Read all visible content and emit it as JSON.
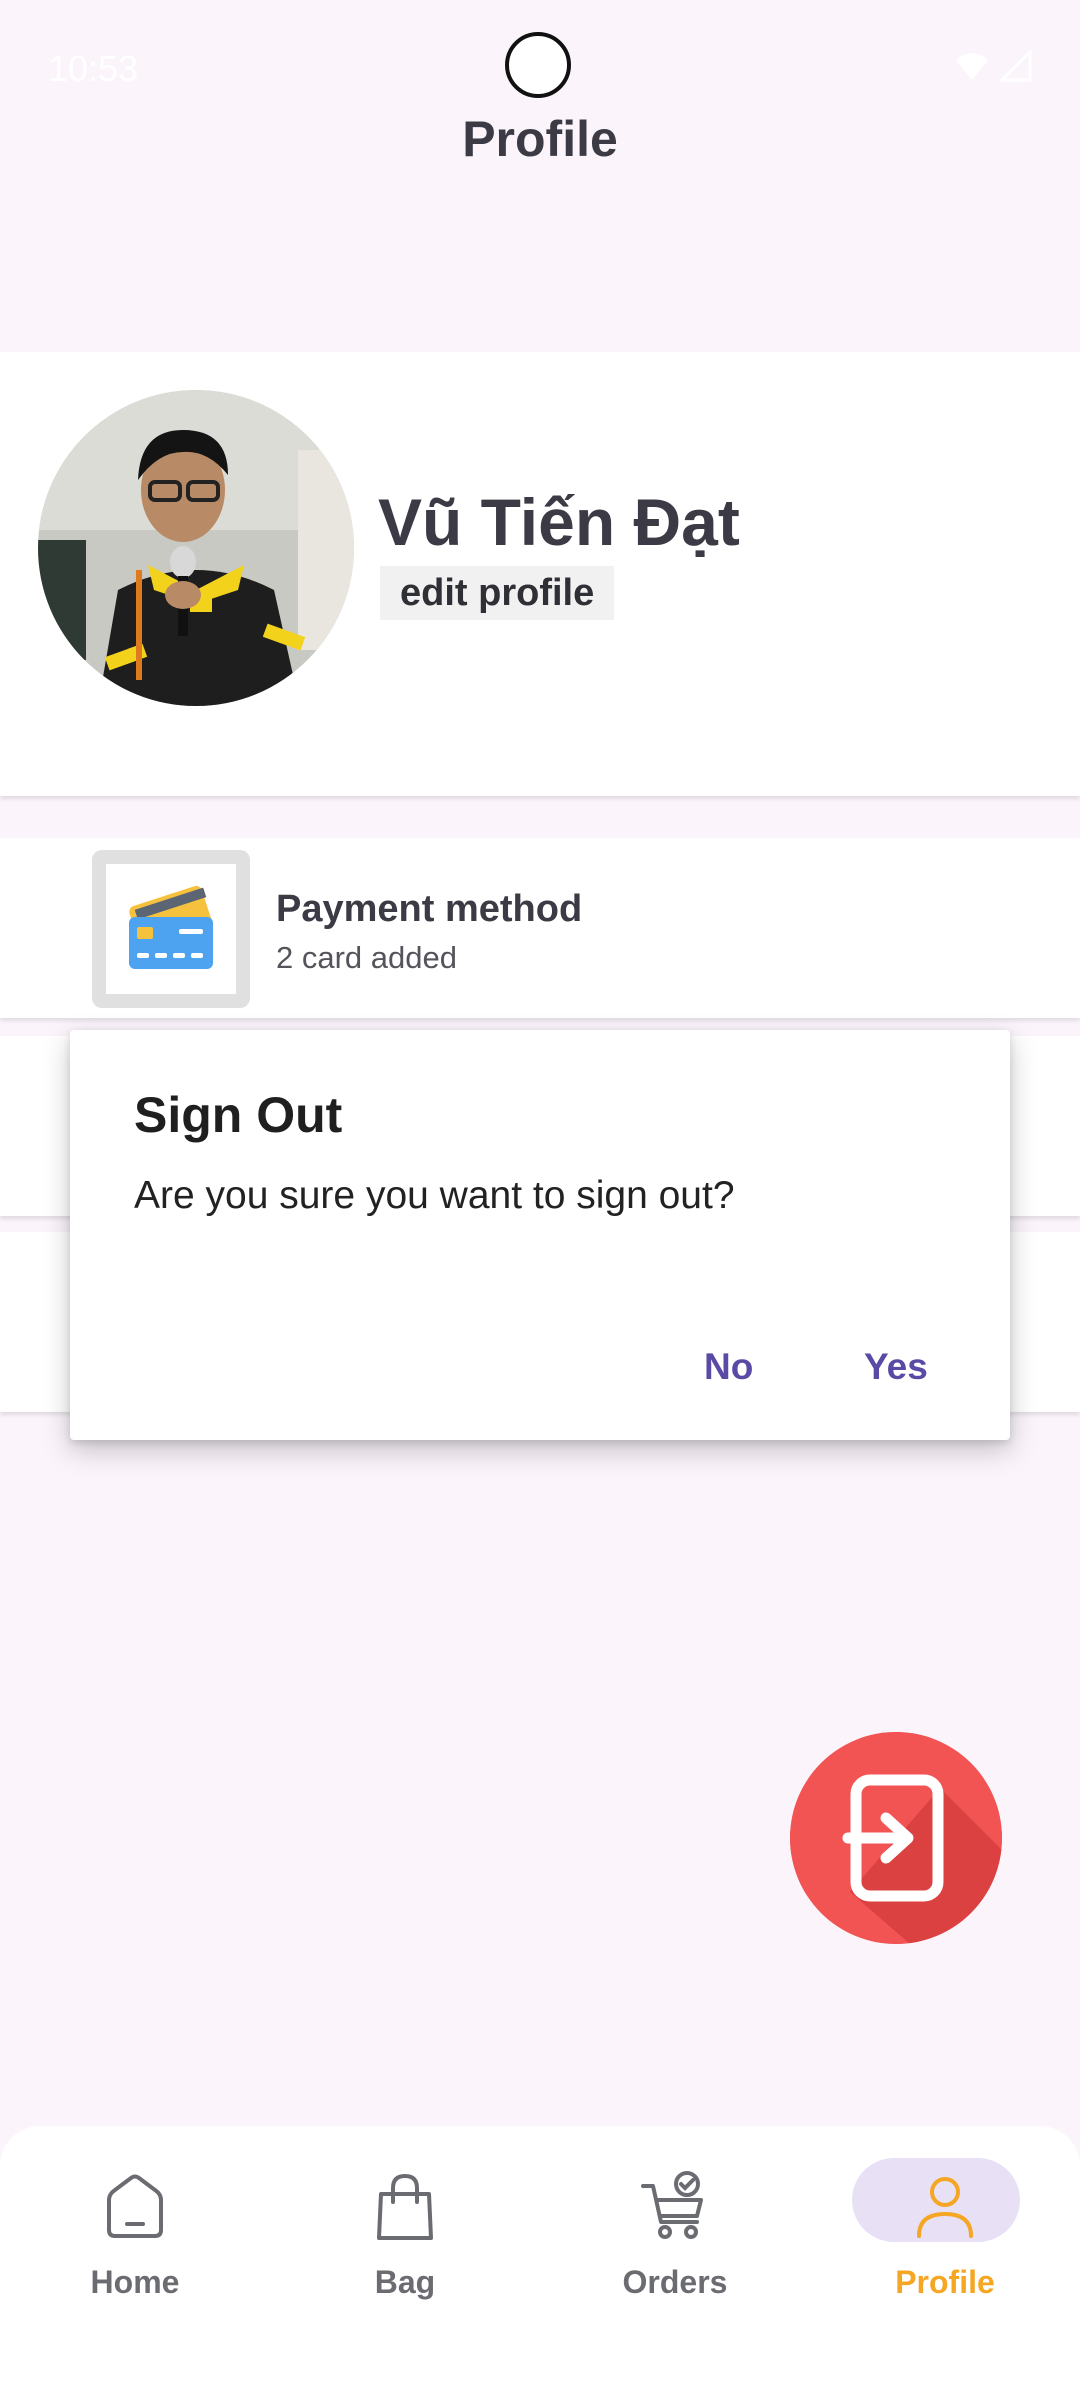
{
  "status_bar": {
    "time": "10:53"
  },
  "header": {
    "title": "Profile"
  },
  "profile": {
    "name": "Vũ Tiến Đạt",
    "edit_label": "edit profile"
  },
  "payment": {
    "title": "Payment method",
    "subtitle": "2 card added"
  },
  "dialog": {
    "title": "Sign Out",
    "message": "Are you sure you want to sign out?",
    "no_label": "No",
    "yes_label": "Yes"
  },
  "fab": {
    "icon": "sign-out-icon",
    "color": "#f25454"
  },
  "nav": {
    "items": [
      {
        "label": "Home",
        "icon": "home-icon"
      },
      {
        "label": "Bag",
        "icon": "bag-icon"
      },
      {
        "label": "Orders",
        "icon": "orders-cart-icon"
      },
      {
        "label": "Profile",
        "icon": "profile-icon",
        "active": true
      }
    ],
    "active_color": "#f5a623",
    "inactive_color": "#6b6b72"
  },
  "colors": {
    "background": "#fbf5fb",
    "dialog_button": "#5a4aa6",
    "active_pill": "#e8e0f5"
  }
}
